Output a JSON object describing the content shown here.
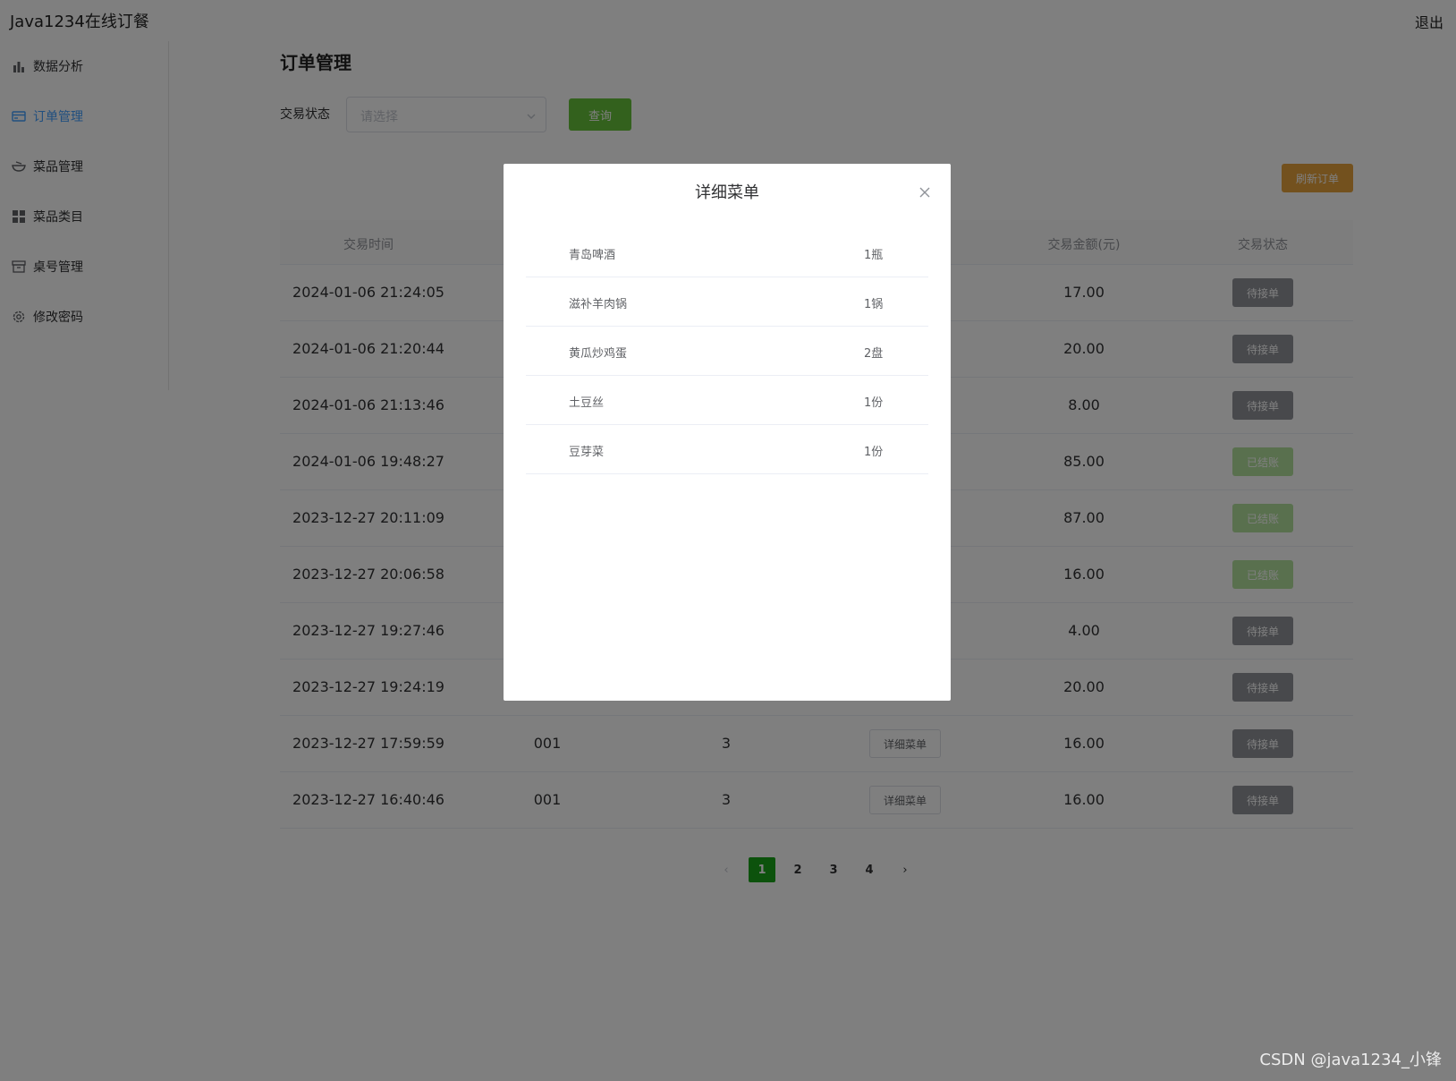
{
  "header": {
    "app_title": "Java1234在线订餐",
    "logout_label": "退出"
  },
  "sidebar": {
    "items": [
      {
        "label": "数据分析",
        "icon": "bar-chart-icon",
        "active": false
      },
      {
        "label": "订单管理",
        "icon": "order-card-icon",
        "active": true
      },
      {
        "label": "菜品管理",
        "icon": "bowl-icon",
        "active": false
      },
      {
        "label": "菜品类目",
        "icon": "grid-icon",
        "active": false
      },
      {
        "label": "桌号管理",
        "icon": "box-icon",
        "active": false
      },
      {
        "label": "修改密码",
        "icon": "gear-icon",
        "active": false
      }
    ]
  },
  "main": {
    "page_title": "订单管理",
    "filter": {
      "label": "交易状态",
      "placeholder": "请选择"
    },
    "query_label": "查询",
    "refresh_label": "刷新订单"
  },
  "table": {
    "headers": [
      "交易时间",
      "",
      "",
      "",
      "交易金额(元)",
      "交易状态"
    ],
    "rows": [
      {
        "time": "2024-01-06 21:24:05",
        "table_no": "",
        "count": "",
        "detail": "",
        "amount": "17.00",
        "status": "待接单",
        "status_type": "pending"
      },
      {
        "time": "2024-01-06 21:20:44",
        "table_no": "",
        "count": "",
        "detail": "",
        "amount": "20.00",
        "status": "待接单",
        "status_type": "pending"
      },
      {
        "time": "2024-01-06 21:13:46",
        "table_no": "",
        "count": "",
        "detail": "",
        "amount": "8.00",
        "status": "待接单",
        "status_type": "pending"
      },
      {
        "time": "2024-01-06 19:48:27",
        "table_no": "",
        "count": "",
        "detail": "",
        "amount": "85.00",
        "status": "已结账",
        "status_type": "done"
      },
      {
        "time": "2023-12-27 20:11:09",
        "table_no": "",
        "count": "",
        "detail": "",
        "amount": "87.00",
        "status": "已结账",
        "status_type": "done"
      },
      {
        "time": "2023-12-27 20:06:58",
        "table_no": "",
        "count": "",
        "detail": "",
        "amount": "16.00",
        "status": "已结账",
        "status_type": "done"
      },
      {
        "time": "2023-12-27 19:27:46",
        "table_no": "",
        "count": "",
        "detail": "",
        "amount": "4.00",
        "status": "待接单",
        "status_type": "pending"
      },
      {
        "time": "2023-12-27 19:24:19",
        "table_no": "",
        "count": "",
        "detail": "",
        "amount": "20.00",
        "status": "待接单",
        "status_type": "pending"
      },
      {
        "time": "2023-12-27 17:59:59",
        "table_no": "001",
        "count": "3",
        "detail": "详细菜单",
        "amount": "16.00",
        "status": "待接单",
        "status_type": "pending"
      },
      {
        "time": "2023-12-27 16:40:46",
        "table_no": "001",
        "count": "3",
        "detail": "详细菜单",
        "amount": "16.00",
        "status": "待接单",
        "status_type": "pending"
      }
    ]
  },
  "pagination": {
    "pages": [
      "1",
      "2",
      "3",
      "4"
    ],
    "current": "1",
    "prev": "‹",
    "next": "›"
  },
  "dialog": {
    "title": "详细菜单",
    "close_icon": "close-icon",
    "items": [
      {
        "name": "青岛啤酒",
        "qty": "1瓶"
      },
      {
        "name": "滋补羊肉锅",
        "qty": "1锅"
      },
      {
        "name": "黄瓜炒鸡蛋",
        "qty": "2盘"
      },
      {
        "name": "土豆丝",
        "qty": "1份"
      },
      {
        "name": "豆芽菜",
        "qty": "1份"
      }
    ]
  },
  "watermark": "CSDN @java1234_小锋",
  "colors": {
    "primary": "#409eff",
    "success": "#67c23a",
    "warning": "#e6a23c",
    "pending": "#909399",
    "done": "#b3e19d",
    "page_active": "#18a518"
  }
}
